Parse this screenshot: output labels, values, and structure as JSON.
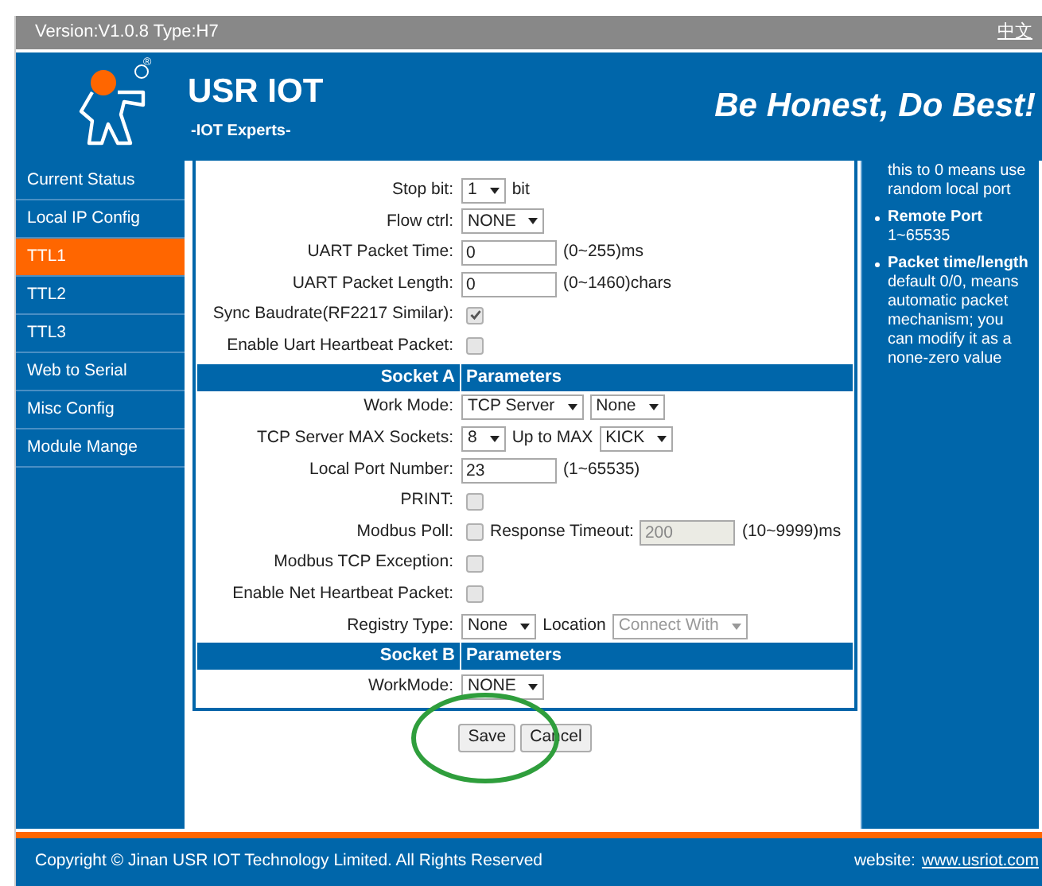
{
  "top_bar": {
    "version": "Version:V1.0.8 Type:H7",
    "language_link": "中文"
  },
  "header": {
    "brand": "USR IOT",
    "tagline": "-IOT Experts-",
    "registered_mark": "®",
    "slogan": "Be Honest, Do Best!"
  },
  "sidebar": {
    "items": [
      {
        "label": "Current Status",
        "selected": false
      },
      {
        "label": "Local IP Config",
        "selected": false
      },
      {
        "label": "TTL1",
        "selected": true
      },
      {
        "label": "TTL2",
        "selected": false
      },
      {
        "label": "TTL3",
        "selected": false
      },
      {
        "label": "Web to Serial",
        "selected": false
      },
      {
        "label": "Misc Config",
        "selected": false
      },
      {
        "label": "Module Mange",
        "selected": false
      }
    ]
  },
  "form": {
    "rows": [
      {
        "kind": "field",
        "label": "Stop bit:",
        "controls": [
          {
            "kind": "select",
            "value": "1",
            "disabled": false
          },
          {
            "kind": "text",
            "text": "bit"
          }
        ]
      },
      {
        "kind": "field",
        "label": "Flow ctrl:",
        "controls": [
          {
            "kind": "select",
            "value": "NONE",
            "disabled": false
          }
        ]
      },
      {
        "kind": "field",
        "label": "UART Packet Time:",
        "controls": [
          {
            "kind": "input",
            "value": "0",
            "disabled": false
          },
          {
            "kind": "text",
            "text": "(0~255)ms"
          }
        ]
      },
      {
        "kind": "field",
        "label": "UART Packet Length:",
        "controls": [
          {
            "kind": "input",
            "value": "0",
            "disabled": false
          },
          {
            "kind": "text",
            "text": "(0~1460)chars"
          }
        ]
      },
      {
        "kind": "field",
        "label": "Sync Baudrate(RF2217 Similar):",
        "controls": [
          {
            "kind": "checkbox",
            "checked": true
          }
        ]
      },
      {
        "kind": "field",
        "label": "Enable Uart Heartbeat Packet:",
        "controls": [
          {
            "kind": "checkbox",
            "checked": false
          }
        ]
      },
      {
        "kind": "header",
        "label": "Socket A",
        "text": "Parameters"
      },
      {
        "kind": "field",
        "label": "Work Mode:",
        "controls": [
          {
            "kind": "select",
            "value": "TCP Server",
            "disabled": false
          },
          {
            "kind": "select",
            "value": "None",
            "disabled": false
          }
        ]
      },
      {
        "kind": "field",
        "label": "TCP Server MAX Sockets:",
        "controls": [
          {
            "kind": "select",
            "value": "8",
            "disabled": false
          },
          {
            "kind": "text",
            "text": "Up to MAX"
          },
          {
            "kind": "select",
            "value": "KICK",
            "disabled": false
          }
        ]
      },
      {
        "kind": "field",
        "label": "Local Port Number:",
        "controls": [
          {
            "kind": "input",
            "value": "23",
            "disabled": false
          },
          {
            "kind": "text",
            "text": "(1~65535)"
          }
        ]
      },
      {
        "kind": "field",
        "label": "PRINT:",
        "controls": [
          {
            "kind": "checkbox",
            "checked": false
          }
        ]
      },
      {
        "kind": "field",
        "label": "Modbus Poll:",
        "controls": [
          {
            "kind": "checkbox",
            "checked": false
          },
          {
            "kind": "text",
            "text": "Response Timeout:"
          },
          {
            "kind": "input",
            "value": "200",
            "disabled": true
          },
          {
            "kind": "text",
            "text": "(10~9999)ms"
          }
        ]
      },
      {
        "kind": "field",
        "label": "Modbus TCP Exception:",
        "controls": [
          {
            "kind": "checkbox",
            "checked": false
          }
        ]
      },
      {
        "kind": "field",
        "label": "Enable Net Heartbeat Packet:",
        "controls": [
          {
            "kind": "checkbox",
            "checked": false
          }
        ]
      },
      {
        "kind": "field",
        "label": "Registry Type:",
        "controls": [
          {
            "kind": "select",
            "value": "None",
            "disabled": false
          },
          {
            "kind": "text",
            "text": "Location"
          },
          {
            "kind": "select",
            "value": "Connect With",
            "disabled": true
          }
        ]
      },
      {
        "kind": "header",
        "label": "Socket B",
        "text": "Parameters"
      },
      {
        "kind": "field",
        "label": "WorkMode:",
        "controls": [
          {
            "kind": "select",
            "value": "NONE",
            "disabled": false
          }
        ]
      }
    ],
    "buttons": [
      "Save",
      "Cancel"
    ]
  },
  "help": {
    "items": [
      {
        "kind": "continuation",
        "text": "this to 0 means use random local port"
      },
      {
        "kind": "bullet",
        "title": "Remote Port",
        "text": "1~65535"
      },
      {
        "kind": "bullet",
        "title": "Packet time/length",
        "text": "default 0/0, means automatic packet mechanism; you can modify it as a none-zero value"
      }
    ]
  },
  "footer": {
    "copyright": "Copyright © Jinan USR IOT Technology Limited. All Rights Reserved",
    "website_label": "website:",
    "website_link": "www.usriot.com"
  }
}
